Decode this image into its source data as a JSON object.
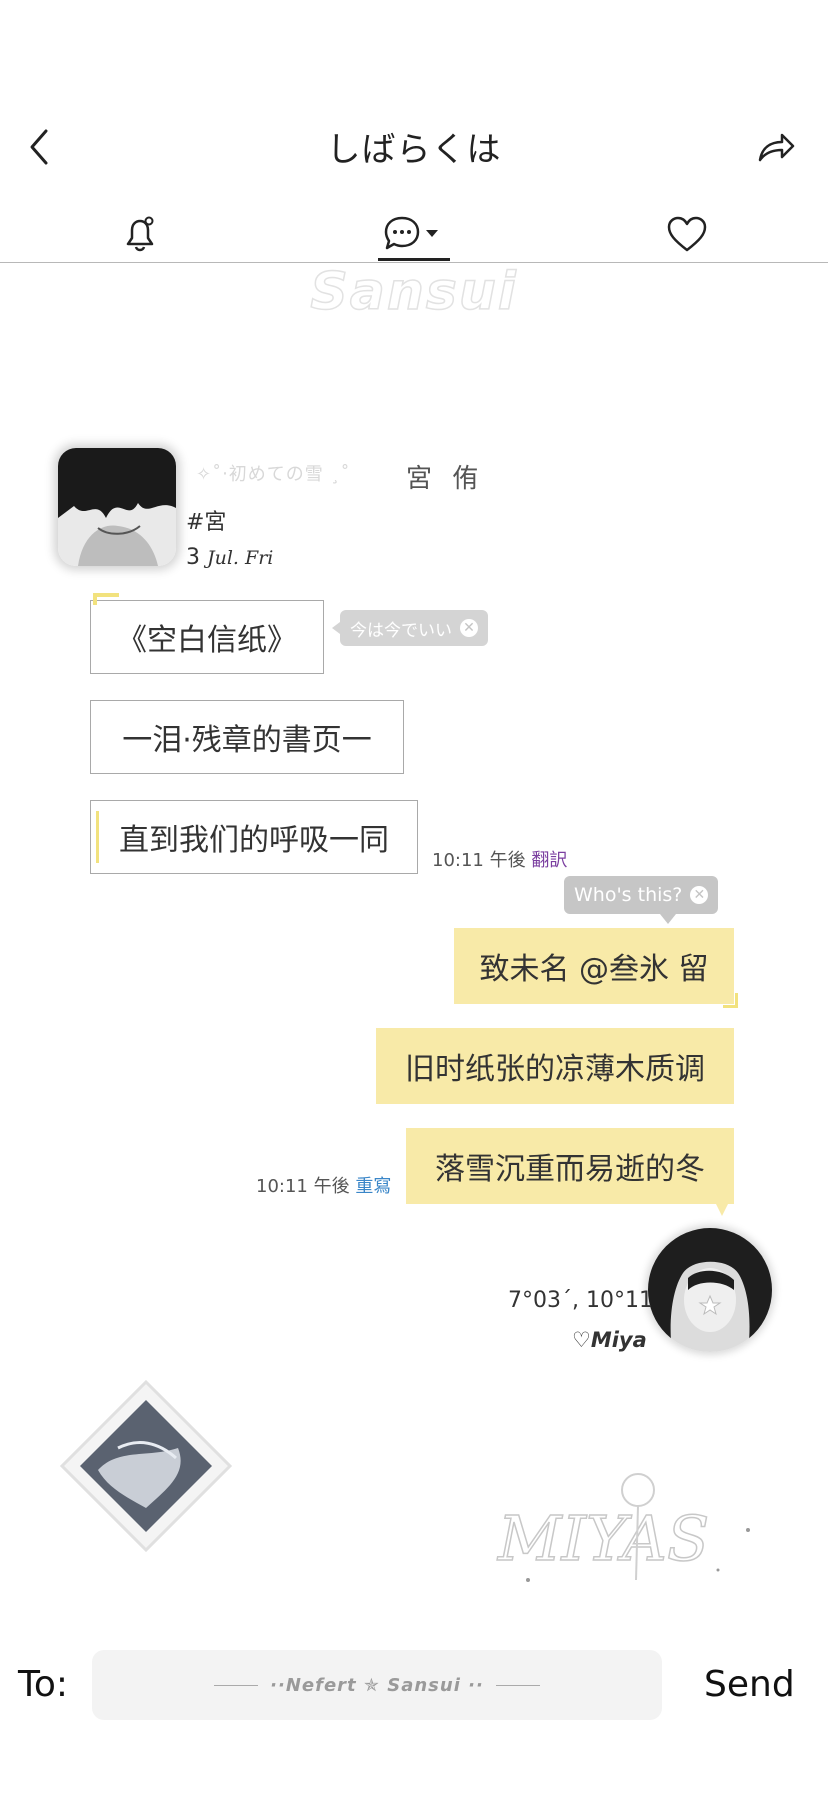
{
  "header": {
    "title": "しばらくは"
  },
  "watermark": "Sansui",
  "profile": {
    "deco_text": "✧˚‧初めての雪 ¸˚",
    "name": "宮 侑",
    "handle": "#宮",
    "date_day": "3",
    "date_text": "Jul. Fri"
  },
  "left_messages": [
    {
      "text": "《空白信纸》"
    },
    {
      "text": "一泪·残章的書页一"
    },
    {
      "text": "直到我们的呼吸一同"
    }
  ],
  "tooltip_left": "今は今でいい",
  "left_meta": {
    "time": "10:11 午後",
    "action": "翻訳"
  },
  "tooltip_right": "Who's this?",
  "right_messages": [
    {
      "text": "致未名 @叁氷 留"
    },
    {
      "text": "旧时纸张的凉薄木质调"
    },
    {
      "text": "落雪沉重而易逝的冬"
    }
  ],
  "right_meta": {
    "time": "10:11 午後",
    "action": "重寫"
  },
  "second_profile": {
    "coords": "7°03´, 10°11",
    "name": "♡Miya"
  },
  "bottom": {
    "to_label": "To:",
    "field_text": "··Nefert ✯ Sansui ··",
    "send_label": "Send"
  },
  "colors": {
    "right_bubble": "#f8eaa8",
    "translate_link": "#7b3fa0",
    "rewrite_link": "#3a86c8"
  }
}
